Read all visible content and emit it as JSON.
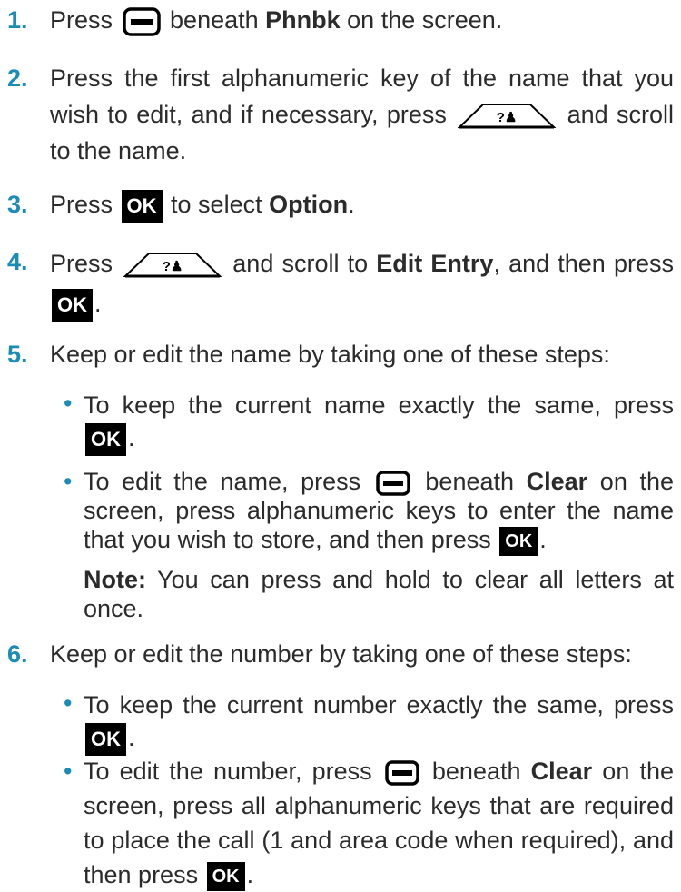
{
  "top_fragment": "",
  "steps": [
    {
      "num": "1.",
      "a": "Press ",
      "b": " beneath ",
      "bold1": "Phnbk",
      "c": " on the screen."
    },
    {
      "num": "2.",
      "a": "Press the first alphanumeric key of the name that you wish to edit, and if necessary, press ",
      "b": " and scroll to the name."
    },
    {
      "num": "3.",
      "a": "Press ",
      "ok": "OK",
      "b": " to select ",
      "bold1": "Option",
      "c": "."
    },
    {
      "num": "4.",
      "a": "Press ",
      "b": " and scroll to ",
      "bold1": "Edit Entry",
      "c": ", and then press ",
      "ok": "OK",
      "d": "."
    },
    {
      "num": "5.",
      "a": "Keep or edit the name by taking one of these steps:"
    },
    {
      "num": "6.",
      "a": "Keep or edit the number by taking one of these steps:"
    }
  ],
  "step5_bullets": [
    {
      "a": "To keep the current name exactly the same, press ",
      "ok": "OK",
      "b": "."
    },
    {
      "a": "To edit the name, press ",
      "b": " beneath ",
      "bold1": "Clear",
      "c": " on the screen, press alphanumeric keys to enter the name that you wish to store, and then press ",
      "ok": "OK",
      "d": "."
    }
  ],
  "step5_note": {
    "label": "Note:",
    "text": " You can press and hold to clear all letters at once."
  },
  "step6_bullets": [
    {
      "a": "To keep the current number exactly the same, press ",
      "ok": "OK",
      "b": "."
    },
    {
      "a": "To edit the number, press ",
      "b": " beneath ",
      "bold1": "Clear",
      "c": " on the screen, press all alphanumeric keys that are required to place the call (1 and area code when required), and then press ",
      "ok": "OK",
      "d": "."
    }
  ],
  "icons": {
    "softkey": "softkey-button-icon",
    "scroll": "scroll-key-icon",
    "ok": "ok-key-icon"
  },
  "colors": {
    "accent": "#1a8cb5",
    "text": "#2b2b2b",
    "ok_bg": "#000000"
  }
}
